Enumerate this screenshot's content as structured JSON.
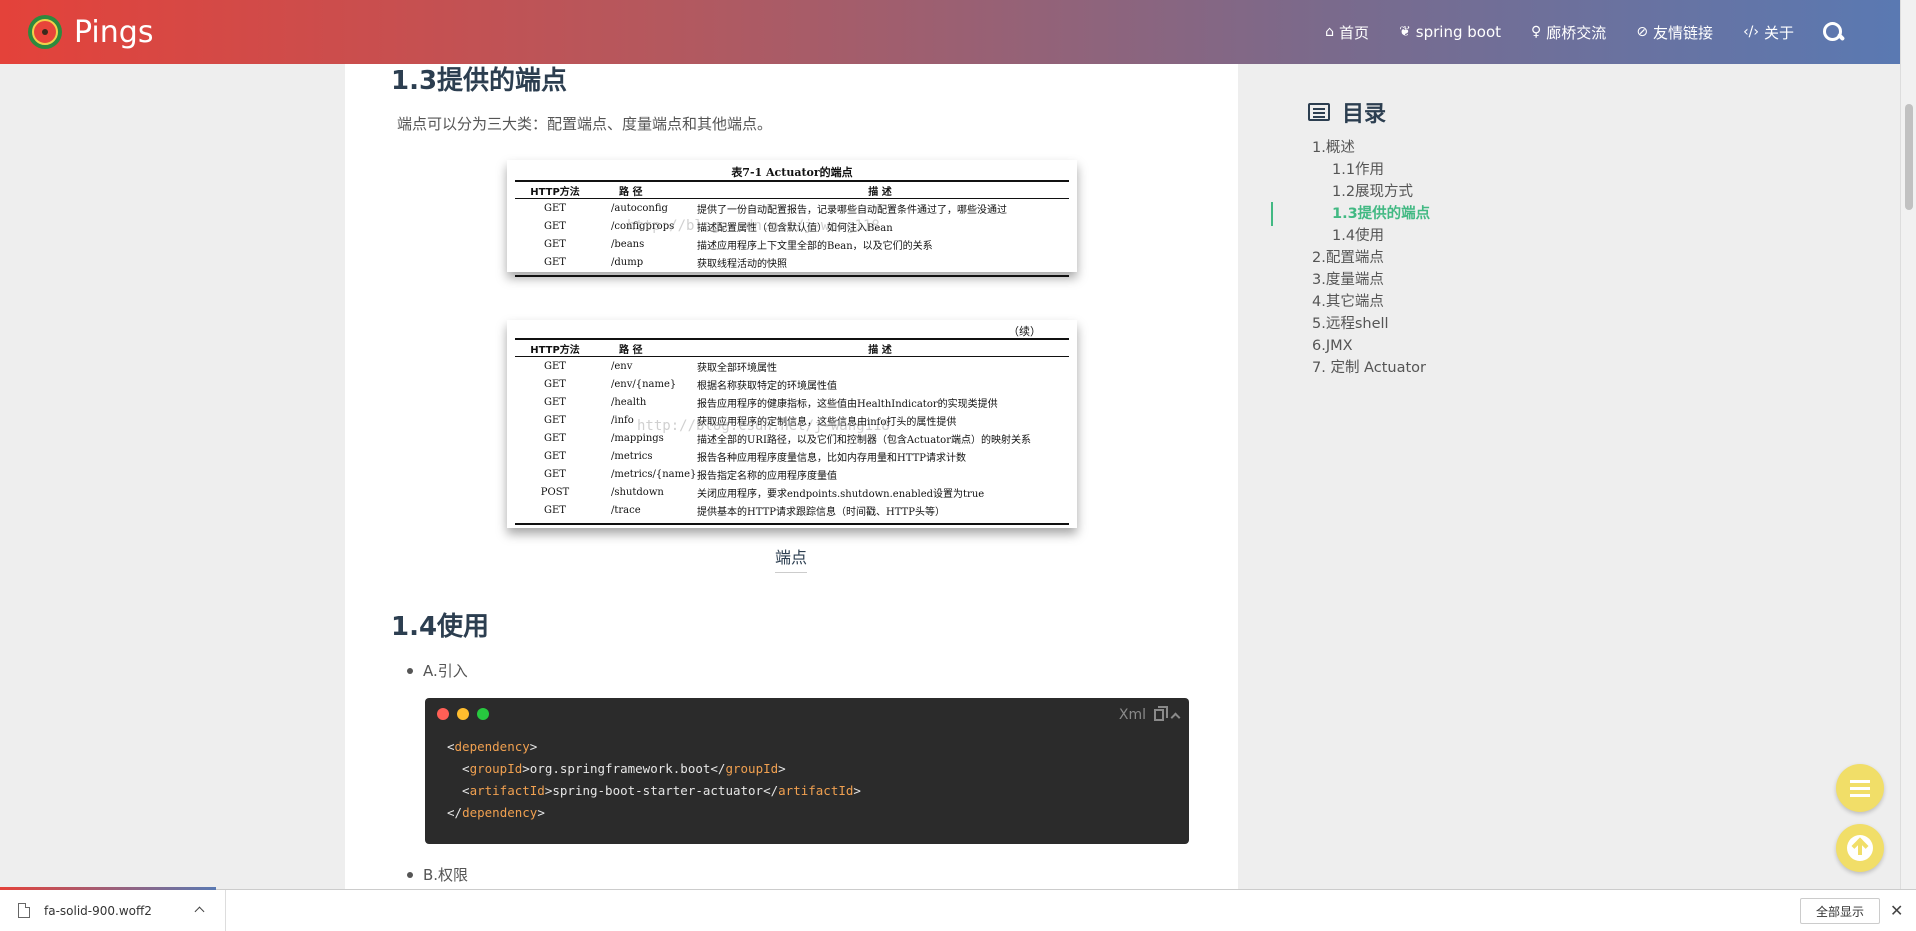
{
  "header": {
    "brand": "Pings",
    "nav": [
      {
        "icon": "home-icon",
        "glyph": "⌂",
        "label": "首页"
      },
      {
        "icon": "leaf-icon",
        "glyph": "❦",
        "label": "spring boot"
      },
      {
        "icon": "lady-icon",
        "glyph": "♀",
        "label": "廊桥交流"
      },
      {
        "icon": "link-icon",
        "glyph": "⊘",
        "label": "友情链接"
      },
      {
        "icon": "code-icon",
        "glyph": "‹/›",
        "label": "关于"
      }
    ]
  },
  "article": {
    "section_title": "1.3提供的端点",
    "intro": "端点可以分为三大类：配置端点、度量端点和其他端点。",
    "table1": {
      "title": "表7-1    Actuator的端点",
      "headers": [
        "HTTP方法",
        "路    径",
        "描    述"
      ],
      "rows": [
        [
          "GET",
          "/autoconfig",
          "提供了一份自动配置报告，记录哪些自动配置条件通过了，哪些没通过"
        ],
        [
          "GET",
          "/configprops",
          "描述配置属性（包含默认值）如何注入Bean"
        ],
        [
          "GET",
          "/beans",
          "描述应用程序上下文里全部的Bean，以及它们的关系"
        ],
        [
          "GET",
          "/dump",
          "获取线程活动的快照"
        ]
      ],
      "watermark": "http://blog.csdn.net/j-wang118"
    },
    "table2": {
      "continued": "（续）",
      "headers": [
        "HTTP方法",
        "路    径",
        "描    述"
      ],
      "rows": [
        [
          "GET",
          "/env",
          "获取全部环境属性"
        ],
        [
          "GET",
          "/env/{name}",
          "根据名称获取特定的环境属性值"
        ],
        [
          "GET",
          "/health",
          "报告应用程序的健康指标，这些值由HealthIndicator的实现类提供"
        ],
        [
          "GET",
          "/info",
          "获取应用程序的定制信息，这些信息由info打头的属性提供"
        ],
        [
          "GET",
          "/mappings",
          "描述全部的URI路径，以及它们和控制器（包含Actuator端点）的映射关系"
        ],
        [
          "GET",
          "/metrics",
          "报告各种应用程序度量信息，比如内存用量和HTTP请求计数"
        ],
        [
          "GET",
          "/metrics/{name}",
          "报告指定名称的应用程序度量值"
        ],
        [
          "POST",
          "/shutdown",
          "关闭应用程序，要求endpoints.shutdown.enabled设置为true"
        ],
        [
          "GET",
          "/trace",
          "提供基本的HTTP请求跟踪信息（时间戳、HTTP头等）"
        ]
      ],
      "watermark": "http://blog.csdn.net/j-wang118"
    },
    "caption": "端点",
    "section2_title": "1.4使用",
    "bullet_a": "A.引入",
    "bullet_b": "B.权限",
    "code": {
      "lang": "Xml",
      "line1_open": "<",
      "line1_tag": "dependency",
      "line1_close": ">",
      "line2_open": "  <",
      "line2_tag": "groupId",
      "line2_mid": ">org.springframework.boot</",
      "line2_tag_end": "groupId",
      "line2_close": ">",
      "line3_open": "  <",
      "line3_tag": "artifactId",
      "line3_mid": ">spring-boot-starter-actuator</",
      "line3_tag_end": "artifactId",
      "line3_close": ">",
      "line4_open": "</",
      "line4_tag": "dependency",
      "line4_close": ">"
    }
  },
  "toc": {
    "title": "目录",
    "items": [
      {
        "label": "1.概述",
        "level": 1
      },
      {
        "label": "1.1作用",
        "level": 2
      },
      {
        "label": "1.2展现方式",
        "level": 2
      },
      {
        "label": "1.3提供的端点",
        "level": 2,
        "active": true
      },
      {
        "label": "1.4使用",
        "level": 2
      },
      {
        "label": "2.配置端点",
        "level": 1
      },
      {
        "label": "3.度量端点",
        "level": 1
      },
      {
        "label": "4.其它端点",
        "level": 1
      },
      {
        "label": "5.远程shell",
        "level": 1
      },
      {
        "label": "6.JMX",
        "level": 1
      },
      {
        "label": "7. 定制 Actuator",
        "level": 1
      }
    ]
  },
  "download": {
    "filename": "fa-solid-900.woff2",
    "show_all": "全部显示",
    "close": "✕"
  },
  "colors": {
    "accent": "#42b983",
    "fab": "#f1de68",
    "code_tag": "#f0a050"
  }
}
